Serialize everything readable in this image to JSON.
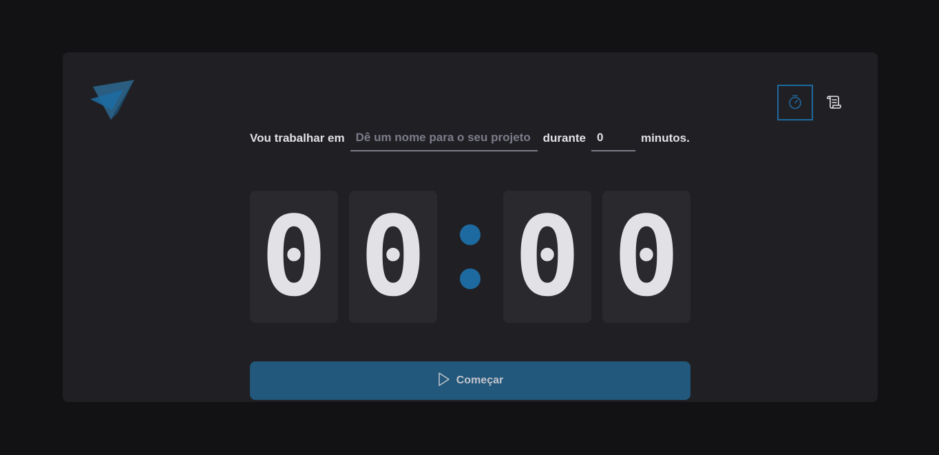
{
  "app": {
    "logo_icon": "paper-plane-logo-icon",
    "accent_color": "#1d6aa0"
  },
  "nav": {
    "timer_icon": "timer-icon",
    "history_icon": "scroll-icon"
  },
  "form": {
    "prefix_label": "Vou trabalhar em",
    "project_value": "",
    "project_placeholder": "Dê um nome para o seu projeto",
    "middle_label": "durante",
    "minutes_value": "0",
    "suffix_label": "minutos."
  },
  "countdown": {
    "minutes_tens": "0",
    "minutes_ones": "0",
    "separator": ":",
    "seconds_tens": "0",
    "seconds_ones": "0"
  },
  "start_button": {
    "label": "Começar",
    "icon": "play-icon"
  }
}
